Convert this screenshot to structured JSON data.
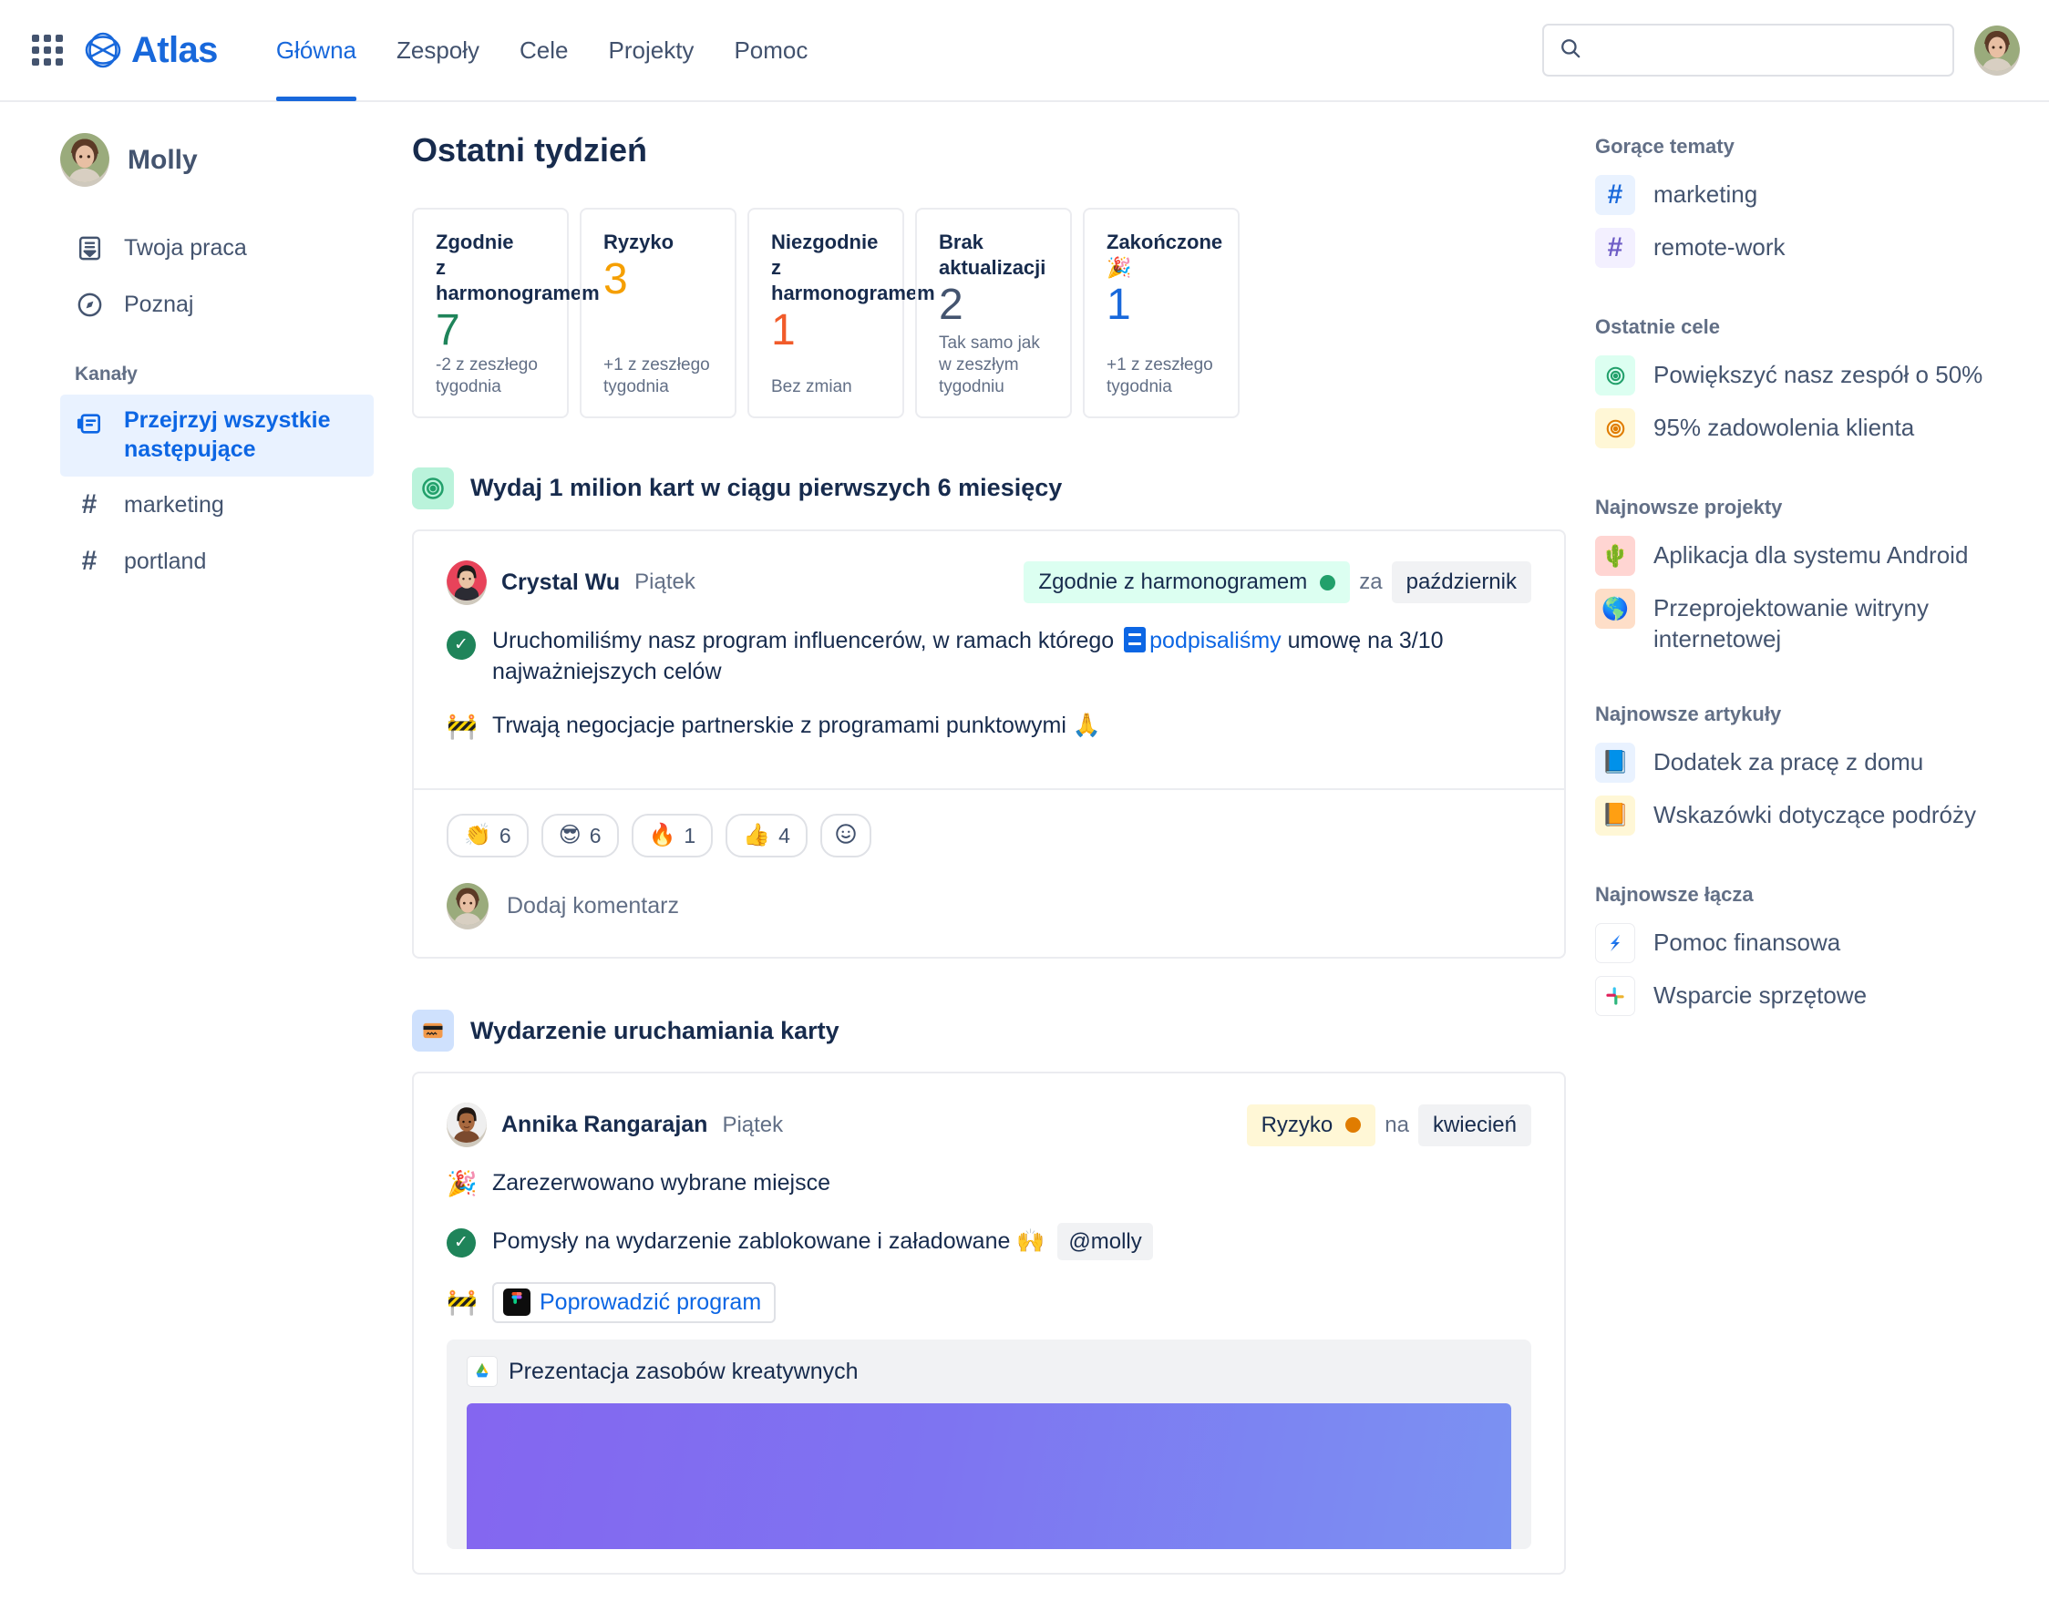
{
  "app": {
    "brand_name": "Atlas",
    "logo_icon": "atlas-logo-icon",
    "apps_icon": "app-switcher-icon"
  },
  "nav": {
    "links": [
      {
        "label": "Główna",
        "active": true
      },
      {
        "label": "Zespoły",
        "active": false
      },
      {
        "label": "Cele",
        "active": false
      },
      {
        "label": "Projekty",
        "active": false
      },
      {
        "label": "Pomoc",
        "active": false
      }
    ],
    "search": {
      "value": "",
      "placeholder": "",
      "icon": "search-icon"
    },
    "avatar_icon": "user-avatar"
  },
  "sidebar": {
    "profile_name": "Molly",
    "items": [
      {
        "label": "Twoja praca",
        "icon": "inbox-icon",
        "active": false
      },
      {
        "label": "Poznaj",
        "icon": "compass-icon",
        "active": false
      }
    ],
    "section_label": "Kanały",
    "channels": [
      {
        "label": "Przejrzyj wszystkie następujące",
        "icon": "feed-icon",
        "active": true
      },
      {
        "label": "marketing",
        "icon": "hash-icon",
        "active": false
      },
      {
        "label": "portland",
        "icon": "hash-icon",
        "active": false
      }
    ]
  },
  "main": {
    "page_title": "Ostatni tydzień",
    "stats": [
      {
        "title": "Zgodnie\nz harmonogramem",
        "value": "7",
        "value_color": "#1F845A",
        "sub": "-2 z zeszłego tygodnia"
      },
      {
        "title": "Ryzyko",
        "value": "3",
        "value_color": "#F59F00",
        "sub": "+1 z zeszłego tygodnia"
      },
      {
        "title": "Niezgodnie\nz harmonogramem",
        "value": "1",
        "value_color": "#F15B2A",
        "sub": "Bez zmian"
      },
      {
        "title": "Brak aktualizacji",
        "value": "2",
        "value_color": "#44546F",
        "sub": "Tak samo jak\nw zeszłym tygodniu"
      },
      {
        "title": "Zakończone 🎉",
        "value": "1",
        "value_color": "#1868DB",
        "sub": "+1 z zeszłego tygodnia"
      }
    ],
    "feeds": [
      {
        "icon": "goal-target-icon",
        "icon_glyph": "◎",
        "icon_bg": "#BAF3DB",
        "icon_color": "#22A06B",
        "title": "Wydaj 1 milion kart w ciągu pierwszych 6 miesięcy",
        "post": {
          "author": "Crystal Wu",
          "when": "Piątek",
          "status_label": "Zgodnie z harmonogramem",
          "status_style": "green",
          "status_dot": "#22A06B",
          "connector": "za",
          "period": "październik",
          "bullets": [
            {
              "glyph": "check",
              "text_before": "Uruchomiliśmy nasz program influencerów, w ramach którego ",
              "link": "podpisaliśmy",
              "text_after": " umowę na 3/10 najważniejszych celów",
              "doc_icon": "document-icon"
            },
            {
              "glyph": "🚧",
              "text_before": "Trwają negocjacje partnerskie z programami punktowymi 🙏",
              "link": "",
              "text_after": ""
            }
          ],
          "reactions": [
            {
              "emoji": "👏",
              "count": "6"
            },
            {
              "emoji": "😎",
              "count": "6"
            },
            {
              "emoji": "🔥",
              "count": "1"
            },
            {
              "emoji": "👍",
              "count": "4"
            },
            {
              "emoji": "☺",
              "count": ""
            }
          ],
          "comment_placeholder": "Dodaj komentarz"
        }
      },
      {
        "icon": "card-project-icon",
        "icon_glyph": "💳",
        "icon_bg": "#CFE1FD",
        "icon_color": "#E07C00",
        "title": "Wydarzenie uruchamiania karty",
        "post": {
          "author": "Annika Rangarajan",
          "when": "Piątek",
          "status_label": "Ryzyko",
          "status_style": "yellow",
          "status_dot": "#E07C00",
          "connector": "na",
          "period": "kwiecień",
          "bullets": [
            {
              "glyph": "🎉",
              "text_before": "Zarezerwowano wybrane miejsce"
            },
            {
              "glyph": "check",
              "text_before": "Pomysły na wydarzenie zablokowane i załadowane 🙌",
              "mention": "@molly"
            },
            {
              "glyph": "🚧",
              "link_chip": "Poprowadzić program",
              "chip_icon": "figma-icon"
            }
          ],
          "embed": {
            "icon": "google-drive-icon",
            "title": "Prezentacja zasobów kreatywnych"
          }
        }
      }
    ]
  },
  "rightbar": {
    "sections": [
      {
        "heading": "Gorące tematy",
        "items": [
          {
            "label": "marketing",
            "icon": "hash-icon",
            "bg": "#E9F2FF",
            "fg": "#1868DB",
            "glyph": "#"
          },
          {
            "label": "remote-work",
            "icon": "hash-icon",
            "bg": "#F3F0FF",
            "fg": "#6E5DC6",
            "glyph": "#"
          }
        ]
      },
      {
        "heading": "Ostatnie cele",
        "items": [
          {
            "label": "Powiększyć nasz zespół o 50%",
            "icon": "goal-target-icon",
            "bg": "#DCFFF1",
            "fg": "#22A06B",
            "glyph": "◎"
          },
          {
            "label": "95% zadowolenia klienta",
            "icon": "goal-target-icon",
            "bg": "#FFF7D6",
            "fg": "#E07C00",
            "glyph": "◎"
          }
        ]
      },
      {
        "heading": "Najnowsze projekty",
        "items": [
          {
            "label": "Aplikacja dla systemu Android",
            "icon": "cactus-icon",
            "bg": "#FFD5D2",
            "fg": "#216E4E",
            "glyph": "🌵"
          },
          {
            "label": "Przeprojektowanie witryny internetowej",
            "icon": "globe-icon",
            "bg": "#FEDEC8",
            "fg": "#1868DB",
            "glyph": "🌎"
          }
        ]
      },
      {
        "heading": "Najnowsze artykuły",
        "items": [
          {
            "label": "Dodatek za pracę z domu",
            "icon": "book-icon",
            "bg": "#E9F2FF",
            "fg": "#1868DB",
            "glyph": "📘"
          },
          {
            "label": "Wskazówki dotyczące podróży",
            "icon": "book-icon",
            "bg": "#FFF7D6",
            "fg": "#E07C00",
            "glyph": "📙"
          }
        ]
      },
      {
        "heading": "Najnowsze łącza",
        "items": [
          {
            "label": "Pomoc finansowa",
            "icon": "jira-icon",
            "bg": "#FFFFFF",
            "fg": "#1868DB",
            "glyph": "jira"
          },
          {
            "label": "Wsparcie sprzętowe",
            "icon": "slack-icon",
            "bg": "#FFFFFF",
            "fg": "#611f69",
            "glyph": "slack"
          }
        ]
      }
    ]
  }
}
